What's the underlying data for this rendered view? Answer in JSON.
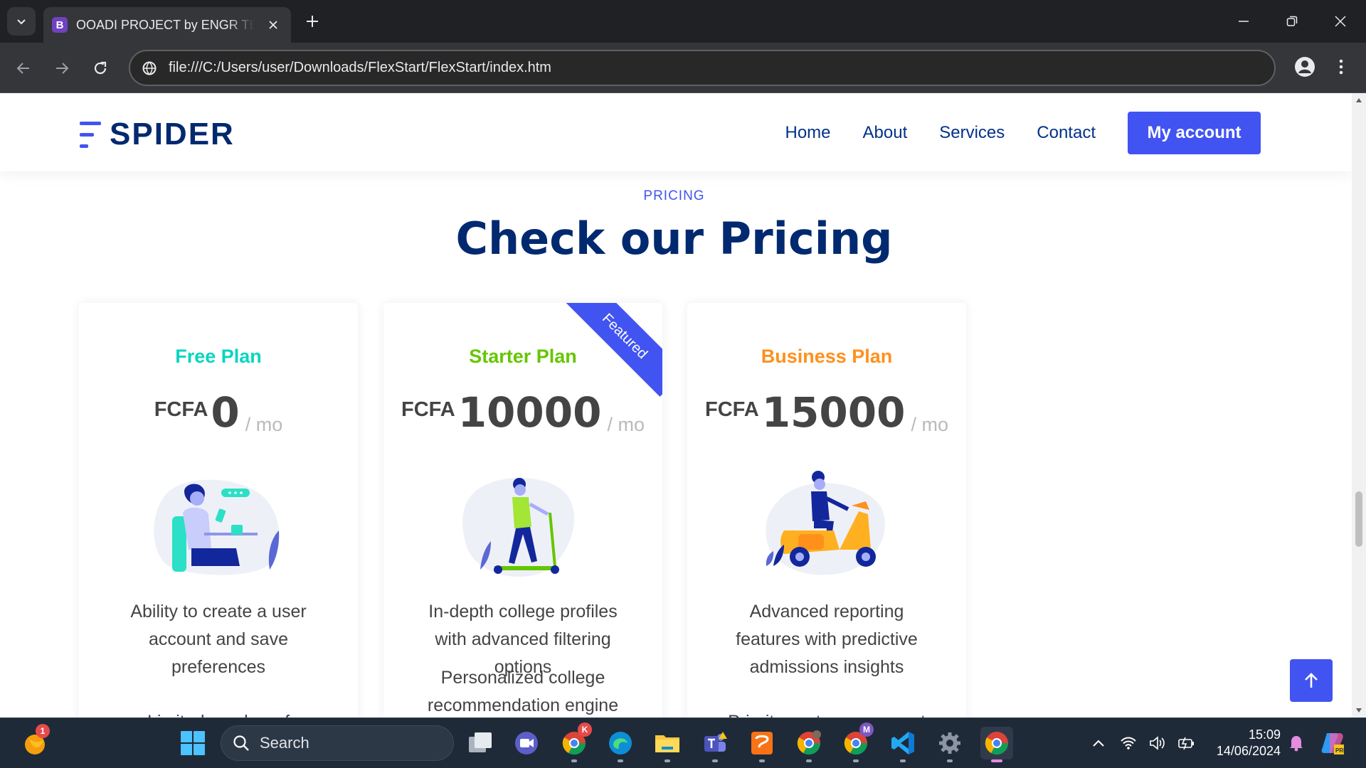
{
  "browser": {
    "tab_favicon": "B",
    "tab_title": "OOADI PROJECT by ENGR TEKO",
    "url": "file:///C:/Users/user/Downloads/FlexStart/FlexStart/index.htm",
    "icons": [
      "tab-search-icon",
      "close-icon",
      "plus-icon",
      "minimize-icon",
      "restore-icon",
      "close-window-icon",
      "back-icon",
      "forward-icon",
      "reload-icon",
      "site-info-icon",
      "profile-icon",
      "more-icon"
    ]
  },
  "site": {
    "logo_text": "SPIDER",
    "nav": [
      "Home",
      "About",
      "Services",
      "Contact"
    ],
    "account_button": "My account",
    "brand_color": "#4154f1",
    "heading_color": "#012970"
  },
  "pricing": {
    "tag": "PRICING",
    "title": "Check our Pricing",
    "plans": [
      {
        "name": "Free Plan",
        "color": "#07d5c0",
        "currency": "FCFA",
        "amount": "0",
        "period": "/ mo",
        "illustration": "person-at-desk-illustration",
        "features": [
          "Ability to create a user account and save preferences",
          "Limited number of"
        ]
      },
      {
        "name": "Starter Plan",
        "color": "#65c600",
        "currency": "FCFA",
        "amount": "10000",
        "period": "/ mo",
        "featured_label": "Featured",
        "illustration": "scooter-rider-illustration",
        "features": [
          "In-depth college profiles with advanced filtering options",
          "Personalized college recommendation engine"
        ]
      },
      {
        "name": "Business Plan",
        "color": "#ff901c",
        "currency": "FCFA",
        "amount": "15000",
        "period": "/ mo",
        "illustration": "motor-scooter-rider-illustration",
        "features": [
          "Advanced reporting features with predictive admissions insights",
          "Priority customer support"
        ]
      }
    ]
  },
  "taskbar": {
    "search_placeholder": "Search",
    "time": "15:09",
    "date": "14/06/2024",
    "widget_badge": "1",
    "apps": [
      "widgets-icon",
      "start-icon",
      "task-view-icon",
      "meet-icon",
      "chrome-profile-k-icon",
      "edge-icon",
      "file-explorer-icon",
      "teams-icon",
      "pdf-app-icon",
      "chrome-profile-photo-icon",
      "chrome-profile-m-icon",
      "vscode-icon",
      "settings-icon",
      "chrome-icon"
    ],
    "tray": [
      "chevron-up-icon",
      "wifi-icon",
      "volume-icon",
      "battery-icon",
      "notification-bell-icon",
      "copilot-icon"
    ]
  }
}
